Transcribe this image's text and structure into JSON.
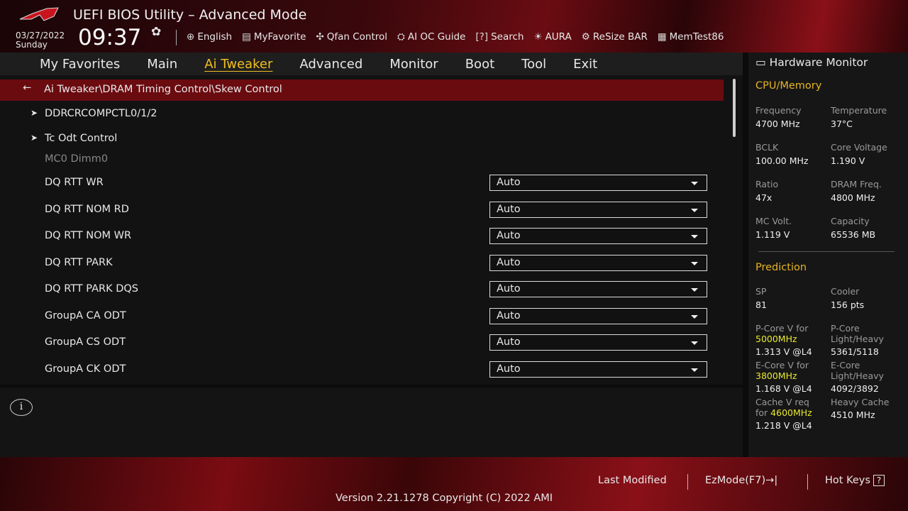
{
  "header": {
    "title": "UEFI BIOS Utility – Advanced Mode",
    "date": "03/27/2022",
    "day": "Sunday",
    "time": "09:37",
    "tools": [
      {
        "icon": "globe-icon",
        "label": "English"
      },
      {
        "icon": "favorite-icon",
        "label": "MyFavorite"
      },
      {
        "icon": "fan-icon",
        "label": "Qfan Control"
      },
      {
        "icon": "ai-chip-icon",
        "label": "AI OC Guide"
      },
      {
        "icon": "search-icon",
        "label": "Search"
      },
      {
        "icon": "aura-icon",
        "label": "AURA"
      },
      {
        "icon": "resize-bar-icon",
        "label": "ReSize BAR"
      },
      {
        "icon": "memtest-icon",
        "label": "MemTest86"
      }
    ]
  },
  "nav": {
    "tabs": [
      "My Favorites",
      "Main",
      "Ai Tweaker",
      "Advanced",
      "Monitor",
      "Boot",
      "Tool",
      "Exit"
    ],
    "active": "Ai Tweaker"
  },
  "main": {
    "path": "Ai Tweaker\\DRAM Timing Control\\Skew Control",
    "submenus": [
      "DDRCRCOMPCTL0/1/2",
      "Tc Odt Control"
    ],
    "section": "MC0 Dimm0",
    "settings": [
      {
        "label": "DQ RTT WR",
        "value": "Auto"
      },
      {
        "label": "DQ RTT NOM RD",
        "value": "Auto"
      },
      {
        "label": "DQ RTT NOM WR",
        "value": "Auto"
      },
      {
        "label": "DQ RTT PARK",
        "value": "Auto"
      },
      {
        "label": "DQ RTT PARK DQS",
        "value": "Auto"
      },
      {
        "label": "GroupA CA ODT",
        "value": "Auto"
      },
      {
        "label": "GroupA CS ODT",
        "value": "Auto"
      },
      {
        "label": "GroupA CK ODT",
        "value": "Auto"
      }
    ]
  },
  "monitor": {
    "title": "Hardware Monitor",
    "cpu_title": "CPU/Memory",
    "cpu": [
      {
        "k": "Frequency",
        "v": "4700 MHz"
      },
      {
        "k": "Temperature",
        "v": "37°C"
      },
      {
        "k": "BCLK",
        "v": "100.00 MHz"
      },
      {
        "k": "Core Voltage",
        "v": "1.190 V"
      },
      {
        "k": "Ratio",
        "v": "47x"
      },
      {
        "k": "DRAM Freq.",
        "v": "4800 MHz"
      },
      {
        "k": "MC Volt.",
        "v": "1.119 V"
      },
      {
        "k": "Capacity",
        "v": "65536 MB"
      }
    ],
    "pred_title": "Prediction",
    "sp": {
      "k": "SP",
      "v": "81"
    },
    "cooler": {
      "k": "Cooler",
      "v": "156 pts"
    },
    "pcore": {
      "k": "P-Core V for",
      "freq": "5000MHz",
      "v": "1.313 V @L4",
      "k2a": "P-Core",
      "k2b": "Light/Heavy",
      "v2": "5361/5118"
    },
    "ecore": {
      "k": "E-Core V for",
      "freq": "3800MHz",
      "v": "1.168 V @L4",
      "k2a": "E-Core",
      "k2b": "Light/Heavy",
      "v2": "4092/3892"
    },
    "cache": {
      "k": "Cache V req",
      "k_for": "for",
      "freq": "4600MHz",
      "v": "1.218 V @L4",
      "k2": "Heavy Cache",
      "v2": "4510 MHz"
    }
  },
  "footer": {
    "last_modified": "Last Modified",
    "ezmode": "EzMode(F7)",
    "ezmode_icon": "→|",
    "hotkeys": "Hot Keys",
    "hotkeys_icon": "?",
    "version": "Version 2.21.1278 Copyright (C) 2022 AMI"
  },
  "colors": {
    "accent": "#f0c020",
    "path_bar": "#6a0b10",
    "prediction_highlight": "#e8e830"
  }
}
